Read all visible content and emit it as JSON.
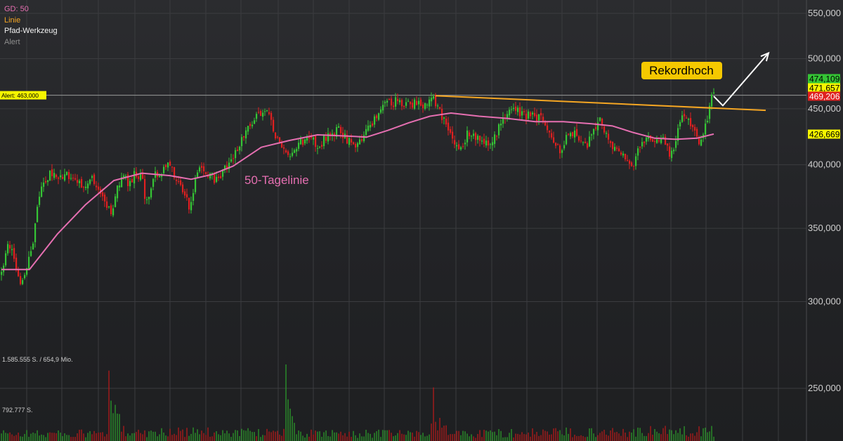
{
  "legend": {
    "gd": "GD: 50",
    "linie": "Linie",
    "pfad": "Pfad-Werkzeug",
    "alert": "Alert"
  },
  "annotations": {
    "alert_label": "Alert: 463,000",
    "rekordhoch": "Rekordhoch",
    "ma_label": "50-Tagelinie"
  },
  "volume": {
    "label_top": "1.585.555 S. / 654,9 Mio.",
    "label_mid": "792.777 S."
  },
  "price_tags": [
    {
      "text": "474,109",
      "value": 474.109,
      "bg": "#35c535",
      "fg": "#000000"
    },
    {
      "text": "471,657",
      "value": 471.657,
      "bg": "#f5f500",
      "fg": "#000000"
    },
    {
      "text": "469,206",
      "value": 469.206,
      "bg": "#e02020",
      "fg": "#ffffff"
    },
    {
      "text": "426,669",
      "value": 426.669,
      "bg": "#f5f500",
      "fg": "#000000"
    }
  ],
  "colors": {
    "up": "#35c535",
    "down": "#e02020",
    "ma": "#e56fb1",
    "trendline": "#f5a623",
    "arrow": "#ffffff",
    "alert_line": "#9a9a9a",
    "grid": "#3b3c3f",
    "axis_text": "#cfcfcf"
  },
  "chart_data": {
    "type": "candlestick",
    "y_scale": "log",
    "ylim": [
      229,
      565
    ],
    "y_ticks": [
      {
        "label": "550,000",
        "value": 550
      },
      {
        "label": "500,000",
        "value": 500
      },
      {
        "label": "450,000",
        "value": 450
      },
      {
        "label": "400,000",
        "value": 400
      },
      {
        "label": "350,000",
        "value": 350
      },
      {
        "label": "300,000",
        "value": 300
      },
      {
        "label": "250,000",
        "value": 250
      }
    ],
    "alert_level": 463,
    "close_trend": [
      [
        0,
        318
      ],
      [
        6,
        335
      ],
      [
        14,
        340
      ],
      [
        22,
        318
      ],
      [
        28,
        308
      ],
      [
        34,
        320
      ],
      [
        44,
        338
      ],
      [
        52,
        372
      ],
      [
        60,
        385
      ],
      [
        70,
        393
      ],
      [
        80,
        388
      ],
      [
        90,
        390
      ],
      [
        100,
        392
      ],
      [
        110,
        386
      ],
      [
        120,
        384
      ],
      [
        130,
        388
      ],
      [
        140,
        378
      ],
      [
        150,
        368
      ],
      [
        156,
        360
      ],
      [
        164,
        380
      ],
      [
        172,
        392
      ],
      [
        180,
        385
      ],
      [
        190,
        392
      ],
      [
        200,
        390
      ],
      [
        206,
        366
      ],
      [
        212,
        382
      ],
      [
        220,
        392
      ],
      [
        230,
        393
      ],
      [
        238,
        405
      ],
      [
        246,
        392
      ],
      [
        254,
        386
      ],
      [
        262,
        374
      ],
      [
        268,
        362
      ],
      [
        276,
        392
      ],
      [
        284,
        398
      ],
      [
        292,
        392
      ],
      [
        300,
        390
      ],
      [
        308,
        387
      ],
      [
        316,
        394
      ],
      [
        326,
        404
      ],
      [
        336,
        412
      ],
      [
        346,
        428
      ],
      [
        356,
        436
      ],
      [
        362,
        445
      ],
      [
        368,
        442
      ],
      [
        374,
        452
      ],
      [
        380,
        444
      ],
      [
        388,
        428
      ],
      [
        396,
        416
      ],
      [
        404,
        408
      ],
      [
        412,
        410
      ],
      [
        420,
        416
      ],
      [
        430,
        420
      ],
      [
        440,
        422
      ],
      [
        450,
        416
      ],
      [
        460,
        422
      ],
      [
        470,
        426
      ],
      [
        480,
        430
      ],
      [
        490,
        424
      ],
      [
        500,
        416
      ],
      [
        510,
        418
      ],
      [
        518,
        430
      ],
      [
        526,
        436
      ],
      [
        534,
        444
      ],
      [
        542,
        452
      ],
      [
        550,
        458
      ],
      [
        558,
        456
      ],
      [
        566,
        458
      ],
      [
        576,
        454
      ],
      [
        586,
        455
      ],
      [
        596,
        453
      ],
      [
        606,
        456
      ],
      [
        614,
        460
      ],
      [
        620,
        452
      ],
      [
        626,
        444
      ],
      [
        632,
        435
      ],
      [
        638,
        426
      ],
      [
        646,
        418
      ],
      [
        654,
        413
      ],
      [
        662,
        426
      ],
      [
        672,
        426
      ],
      [
        682,
        421
      ],
      [
        692,
        418
      ],
      [
        702,
        424
      ],
      [
        712,
        437
      ],
      [
        720,
        446
      ],
      [
        728,
        452
      ],
      [
        738,
        447
      ],
      [
        748,
        444
      ],
      [
        758,
        442
      ],
      [
        768,
        441
      ],
      [
        778,
        430
      ],
      [
        786,
        422
      ],
      [
        794,
        413
      ],
      [
        802,
        420
      ],
      [
        810,
        430
      ],
      [
        818,
        426
      ],
      [
        826,
        423
      ],
      [
        834,
        418
      ],
      [
        842,
        429
      ],
      [
        850,
        441
      ],
      [
        858,
        430
      ],
      [
        866,
        418
      ],
      [
        874,
        413
      ],
      [
        882,
        412
      ],
      [
        890,
        406
      ],
      [
        898,
        396
      ],
      [
        906,
        413
      ],
      [
        914,
        422
      ],
      [
        922,
        426
      ],
      [
        930,
        418
      ],
      [
        938,
        424
      ],
      [
        946,
        420
      ],
      [
        952,
        404
      ],
      [
        958,
        418
      ],
      [
        966,
        438
      ],
      [
        974,
        443
      ],
      [
        982,
        436
      ],
      [
        990,
        423
      ],
      [
        996,
        418
      ],
      [
        1002,
        432
      ],
      [
        1008,
        452
      ],
      [
        1014,
        469.2
      ]
    ],
    "ma50": [
      [
        0,
        321
      ],
      [
        40,
        321
      ],
      [
        80,
        346
      ],
      [
        120,
        368
      ],
      [
        160,
        387
      ],
      [
        200,
        393
      ],
      [
        240,
        391
      ],
      [
        270,
        388
      ],
      [
        300,
        392
      ],
      [
        330,
        399
      ],
      [
        370,
        415
      ],
      [
        410,
        421
      ],
      [
        450,
        426
      ],
      [
        490,
        425
      ],
      [
        520,
        424
      ],
      [
        550,
        430
      ],
      [
        580,
        437
      ],
      [
        610,
        443
      ],
      [
        640,
        446
      ],
      [
        680,
        443
      ],
      [
        720,
        441
      ],
      [
        760,
        438
      ],
      [
        800,
        438
      ],
      [
        840,
        436
      ],
      [
        870,
        434
      ],
      [
        900,
        428
      ],
      [
        930,
        423
      ],
      [
        960,
        422
      ],
      [
        990,
        423
      ],
      [
        1014,
        426.7
      ]
    ],
    "volume_trend": [
      [
        0,
        0.1
      ],
      [
        150,
        0.1
      ],
      [
        155,
        0.4
      ],
      [
        180,
        0.12
      ],
      [
        400,
        0.12
      ],
      [
        405,
        0.45
      ],
      [
        420,
        0.1
      ],
      [
        610,
        0.1
      ],
      [
        614,
        0.3
      ],
      [
        640,
        0.1
      ],
      [
        1014,
        0.14
      ]
    ],
    "trendline": {
      "start": [
        618,
        462.5
      ],
      "end": [
        1088,
        448.5
      ]
    },
    "path_tool": [
      [
        1014,
        462
      ],
      [
        1027,
        453
      ],
      [
        1092,
        506
      ]
    ]
  }
}
